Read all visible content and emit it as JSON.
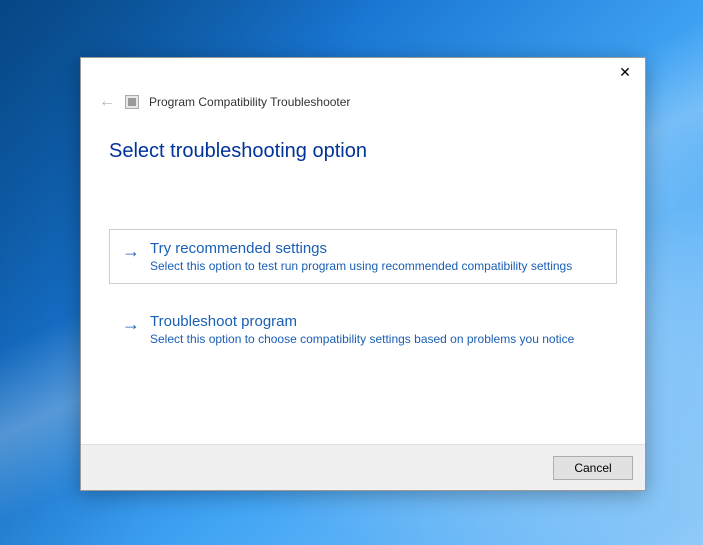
{
  "header": {
    "title": "Program Compatibility Troubleshooter"
  },
  "instruction": "Select troubleshooting option",
  "options": [
    {
      "title": "Try recommended settings",
      "desc": "Select this option to test run program using recommended compatibility settings"
    },
    {
      "title": "Troubleshoot program",
      "desc": "Select this option to choose compatibility settings based on problems you notice"
    }
  ],
  "buttons": {
    "cancel": "Cancel"
  }
}
